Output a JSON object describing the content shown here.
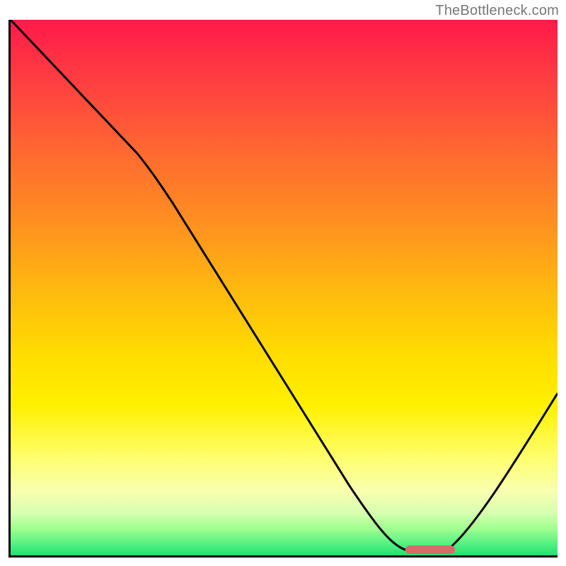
{
  "watermark": "TheBottleneck.com",
  "chart_data": {
    "type": "line",
    "title": "",
    "xlabel": "",
    "ylabel": "",
    "xlim": [
      0,
      100
    ],
    "ylim": [
      0,
      100
    ],
    "series": [
      {
        "name": "bottleneck-curve",
        "x": [
          0,
          12,
          24,
          40,
          55,
          65,
          70,
          74,
          80,
          88,
          100
        ],
        "y": [
          100,
          85,
          70,
          45,
          22,
          8,
          2,
          0,
          0,
          10,
          30
        ]
      }
    ],
    "optimum_range_x": [
      72,
      82
    ],
    "gradient_stops": [
      {
        "pos": 0,
        "color": "#ff1a4a"
      },
      {
        "pos": 50,
        "color": "#ffdb00"
      },
      {
        "pos": 100,
        "color": "#20e070"
      }
    ]
  }
}
